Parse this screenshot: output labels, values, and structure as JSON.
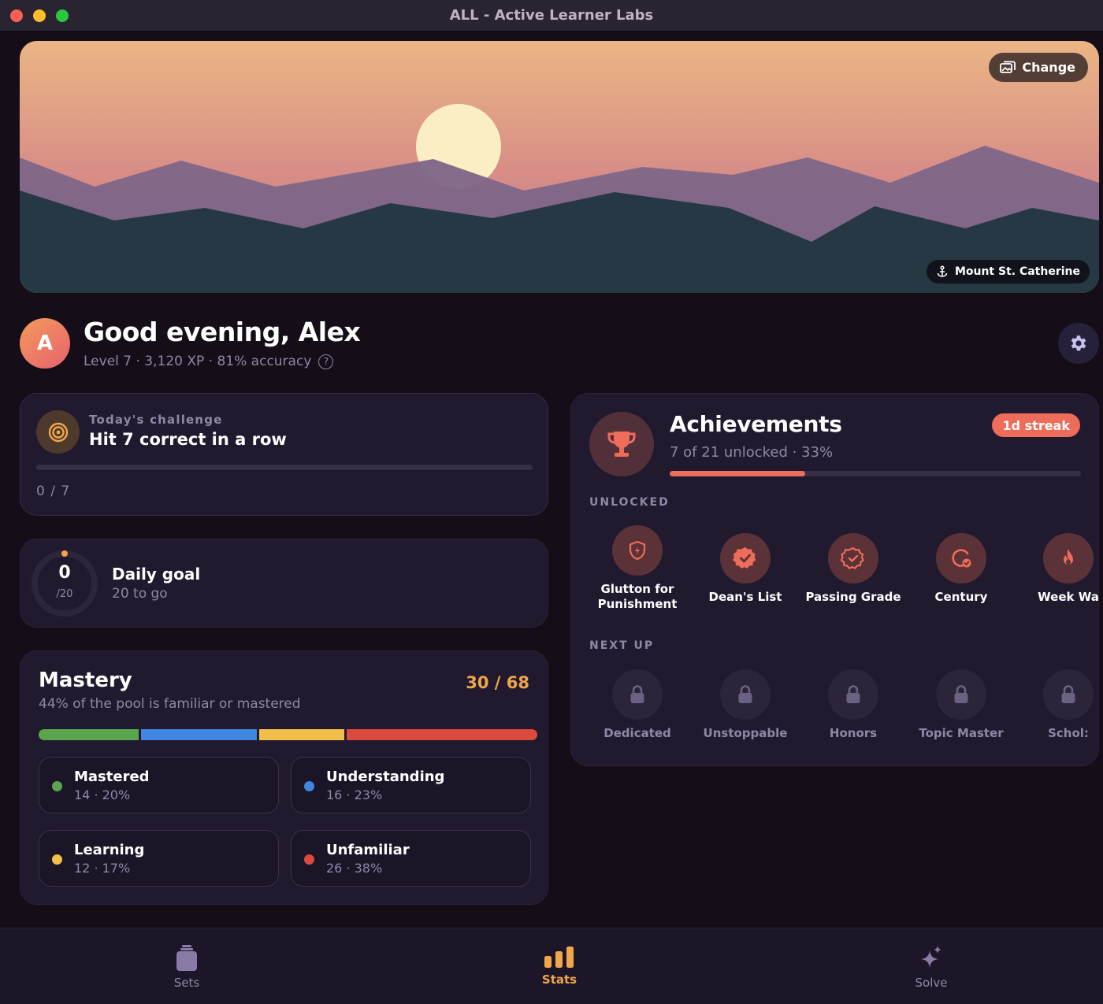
{
  "window": {
    "title": "ALL - Active Learner Labs"
  },
  "hero": {
    "change_label": "Change",
    "location": "Mount St. Catherine",
    "icons": [
      "images-icon",
      "anchor-icon"
    ]
  },
  "profile": {
    "avatar_letter": "A",
    "greeting": "Good evening, Alex",
    "stats": "Level 7 · 3,120 XP · 81% accuracy",
    "help_icon": "?"
  },
  "challenge": {
    "kicker": "Today's challenge",
    "title": "Hit 7 correct in a row",
    "progress": "0 / 7",
    "progress_fraction": 0
  },
  "daily_goal": {
    "value": "0",
    "denominator": "/20",
    "title": "Daily goal",
    "subtitle": "20 to go",
    "progress_fraction": 0
  },
  "mastery": {
    "title": "Mastery",
    "subtitle": "44% of the pool is familiar or mastered",
    "count": "30 / 68",
    "levels": [
      {
        "label": "Mastered",
        "stat": "14 · 20%",
        "color": "#5aa64f",
        "share": 20
      },
      {
        "label": "Understanding",
        "stat": "16 · 23%",
        "color": "#3f86e0",
        "share": 23
      },
      {
        "label": "Learning",
        "stat": "12 · 17%",
        "color": "#f2c04a",
        "share": 17
      },
      {
        "label": "Unfamiliar",
        "stat": "26 · 38%",
        "color": "#db4a3f",
        "share": 38
      }
    ]
  },
  "achievements": {
    "title": "Achievements",
    "subtitle": "7 of 21 unlocked · 33%",
    "streak": "1d streak",
    "progress_fraction": 0.33,
    "unlocked_label": "UNLOCKED",
    "next_label": "NEXT UP",
    "unlocked": [
      {
        "name": "Glutton for Punishment",
        "line1": "Glutton for",
        "line2": "Punishment",
        "icon": "shield-bolt-icon"
      },
      {
        "name": "Dean's List",
        "icon": "seal-check-icon"
      },
      {
        "name": "Passing Grade",
        "icon": "seal-check-outline-icon"
      },
      {
        "name": "Century",
        "icon": "century-icon"
      },
      {
        "name": "Week Wa",
        "icon": "flame-icon"
      }
    ],
    "next_up": [
      {
        "name": "Dedicated",
        "icon": "lock-icon"
      },
      {
        "name": "Unstoppable",
        "icon": "lock-icon"
      },
      {
        "name": "Honors",
        "icon": "lock-icon"
      },
      {
        "name": "Topic Master",
        "icon": "lock-icon"
      },
      {
        "name": "Schol:",
        "icon": "lock-icon"
      }
    ]
  },
  "tabbar": {
    "tabs": [
      {
        "label": "Sets",
        "icon": "jar-icon",
        "active": false
      },
      {
        "label": "Stats",
        "icon": "bar-chart-icon",
        "active": true
      },
      {
        "label": "Solve",
        "icon": "sparkle-icon",
        "active": false
      }
    ]
  },
  "colors": {
    "accent": "#f2a64a",
    "coral": "#ee6c5a",
    "background": "#150e19",
    "card": "#211a2f"
  }
}
